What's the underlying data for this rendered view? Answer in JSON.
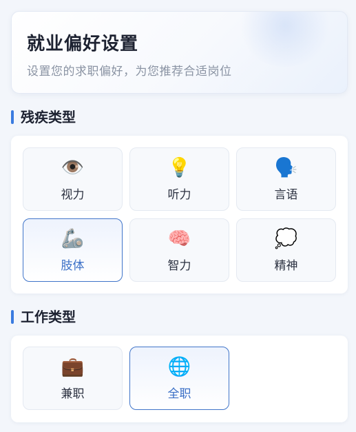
{
  "header": {
    "title": "就业偏好设置",
    "subtitle": "设置您的求职偏好，为您推荐合适岗位"
  },
  "disability_section": {
    "title": "残疾类型",
    "options": [
      {
        "label": "视力",
        "icon": "👁️",
        "icon_name": "eye-icon",
        "selected": false
      },
      {
        "label": "听力",
        "icon": "💡",
        "icon_name": "lightbulb-icon",
        "selected": false
      },
      {
        "label": "言语",
        "icon": "🗣️",
        "icon_name": "speaking-head-icon",
        "selected": false
      },
      {
        "label": "肢体",
        "icon": "🦾",
        "icon_name": "mechanical-arm-icon",
        "selected": true
      },
      {
        "label": "智力",
        "icon": "🧠",
        "icon_name": "brain-icon",
        "selected": false
      },
      {
        "label": "精神",
        "icon": "💭",
        "icon_name": "thought-bubble-icon",
        "selected": false
      }
    ]
  },
  "work_section": {
    "title": "工作类型",
    "options": [
      {
        "label": "兼职",
        "icon": "💼",
        "icon_name": "briefcase-icon",
        "selected": false
      },
      {
        "label": "全职",
        "icon": "🌐",
        "icon_name": "globe-icon",
        "selected": true
      }
    ]
  },
  "colors": {
    "accent": "#3a7be0",
    "selected_border": "#3f74c9",
    "selected_text": "#3a6fc6"
  }
}
